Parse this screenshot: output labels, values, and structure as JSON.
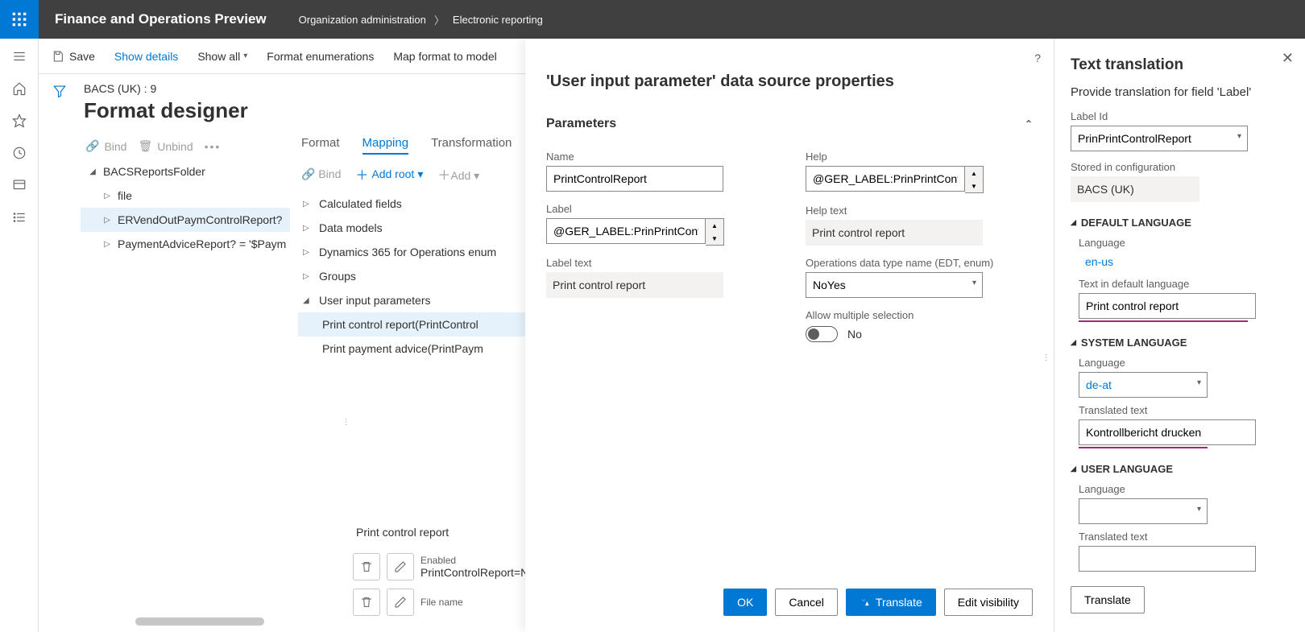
{
  "topbar": {
    "appTitle": "Finance and Operations Preview",
    "breadcrumb": [
      "Organization administration",
      "Electronic reporting"
    ]
  },
  "cmdbar": {
    "save": "Save",
    "showDetails": "Show details",
    "showAll": "Show all",
    "formatEnum": "Format enumerations",
    "mapFormat": "Map format to model"
  },
  "page": {
    "path": "BACS (UK) : 9",
    "title": "Format designer"
  },
  "leftTree": {
    "tools": {
      "bind": "Bind",
      "unbind": "Unbind"
    },
    "root": "BACSReportsFolder",
    "items": [
      "file",
      "ERVendOutPaymControlReport?",
      "PaymentAdviceReport? = '$Paym"
    ]
  },
  "tabs": {
    "format": "Format",
    "mapping": "Mapping",
    "transform": "Transformation"
  },
  "rightTools": {
    "bind": "Bind",
    "addRoot": "Add root",
    "add": "Add"
  },
  "rightTree": {
    "items": [
      "Calculated fields",
      "Data models",
      "Dynamics 365 for Operations enum",
      "Groups"
    ],
    "expanded": "User input parameters",
    "children": [
      "Print control report(PrintControl",
      "Print payment advice(PrintPaym"
    ]
  },
  "bottom": {
    "caption": "Print control report",
    "p1": {
      "label": "Enabled",
      "value": "PrintControlReport=NoYes."
    },
    "p2": {
      "label": "File name",
      "value": ""
    }
  },
  "panel1": {
    "title": "'User input parameter' data source properties",
    "section": "Parameters",
    "name": {
      "label": "Name",
      "value": "PrintControlReport"
    },
    "label": {
      "label": "Label",
      "value": "@GER_LABEL:PrinPrintContro"
    },
    "labelText": {
      "label": "Label text",
      "value": "Print control report"
    },
    "help": {
      "label": "Help",
      "value": "@GER_LABEL:PrinPrintContro"
    },
    "helpText": {
      "label": "Help text",
      "value": "Print control report"
    },
    "edt": {
      "label": "Operations data type name (EDT, enum)",
      "value": "NoYes"
    },
    "allowMulti": {
      "label": "Allow multiple selection",
      "value": "No"
    },
    "buttons": {
      "ok": "OK",
      "cancel": "Cancel",
      "translate": "Translate",
      "editVis": "Edit visibility"
    }
  },
  "panel2": {
    "title": "Text translation",
    "subtitle": "Provide translation for field 'Label'",
    "labelId": {
      "label": "Label Id",
      "value": "PrinPrintControlReport"
    },
    "stored": {
      "label": "Stored in configuration",
      "value": "BACS (UK)"
    },
    "g1": "DEFAULT LANGUAGE",
    "defLang": {
      "label": "Language",
      "value": "en-us"
    },
    "defText": {
      "label": "Text in default language",
      "value": "Print control report"
    },
    "g2": "SYSTEM LANGUAGE",
    "sysLang": {
      "label": "Language",
      "value": "de-at"
    },
    "sysText": {
      "label": "Translated text",
      "value": "Kontrollbericht drucken"
    },
    "g3": "USER LANGUAGE",
    "usrLang": {
      "label": "Language",
      "value": ""
    },
    "usrText": {
      "label": "Translated text",
      "value": ""
    },
    "translate": "Translate"
  }
}
